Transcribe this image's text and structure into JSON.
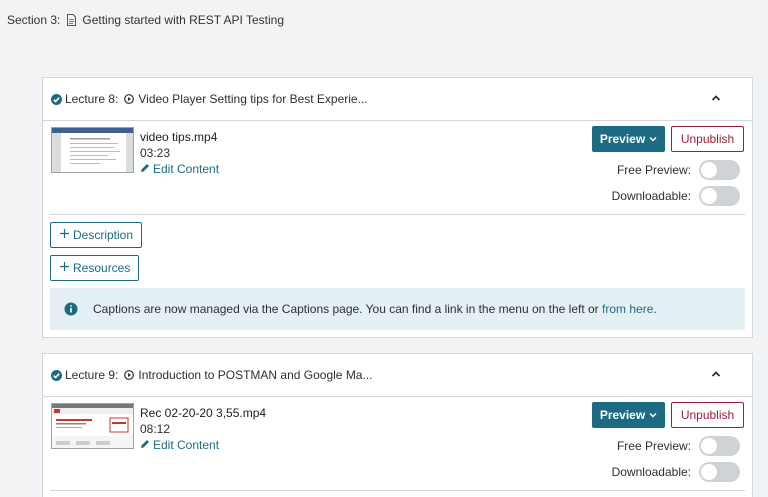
{
  "section": {
    "label": "Section 3:",
    "title": "Getting started with REST API Testing"
  },
  "lectures": [
    {
      "label": "Lecture 8:",
      "title": "Video Player Setting tips for Best Experie...",
      "file_name": "video tips.mp4",
      "duration": "03:23",
      "edit_label": "Edit Content",
      "preview_label": "Preview",
      "unpublish_label": "Unpublish",
      "free_preview_label": "Free Preview:",
      "downloadable_label": "Downloadable:",
      "free_preview": false,
      "downloadable": false,
      "description_label": "Description",
      "resources_label": "Resources",
      "notice_text": "Captions are now managed via the Captions page. You can find a link in the menu on the left or ",
      "notice_link": "from here",
      "notice_end": "."
    },
    {
      "label": "Lecture 9:",
      "title": "Introduction to POSTMAN and Google Ma...",
      "file_name": "Rec 02-20-20 3,55.mp4",
      "duration": "08:12",
      "edit_label": "Edit Content",
      "preview_label": "Preview",
      "unpublish_label": "Unpublish",
      "free_preview_label": "Free Preview:",
      "downloadable_label": "Downloadable:",
      "free_preview": false,
      "downloadable": false
    }
  ],
  "colors": {
    "accent": "#1d6b82",
    "danger": "#9b1f3a",
    "notice_bg": "#e5f0f4"
  }
}
